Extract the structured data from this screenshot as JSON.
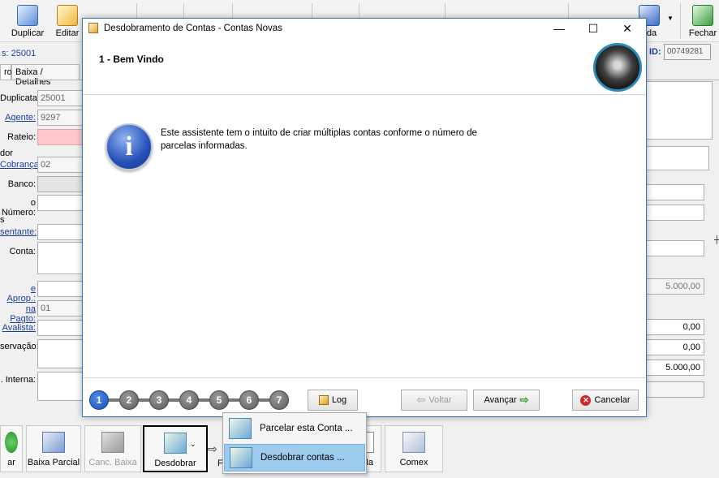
{
  "toolbar": {
    "items": [
      {
        "label": "Duplicar",
        "icon": "duplicate-icon"
      },
      {
        "label": "Editar",
        "icon": "edit-icon"
      },
      {
        "label": "uda",
        "icon": "help-icon"
      },
      {
        "label": "Fechar",
        "icon": "close-app-icon"
      }
    ]
  },
  "form": {
    "header_number": "s: 25001",
    "id_label": "ID:",
    "id_value": "00749281",
    "tabs": [
      "ro",
      "Baixa / Detalhes"
    ],
    "fields": {
      "duplicata": {
        "label": "Duplicata:",
        "value": "25001"
      },
      "agente": {
        "label": "Agente:",
        "value": "9297"
      },
      "rateio": {
        "label": "Rateio:"
      },
      "section_dor": "dor",
      "cobranca": {
        "label": "Cobrança:",
        "value": "02"
      },
      "banco": {
        "label": "Banco:"
      },
      "numero": {
        "label": "o Número:"
      },
      "section_s": "s",
      "sentante": {
        "label": "sentante:"
      },
      "conta": {
        "label": "Conta:"
      },
      "aprop": {
        "label": "e Aprop.:"
      },
      "pagto": {
        "label": "na Pagto:",
        "value": "01"
      },
      "avalista": {
        "label": "Avalista:"
      },
      "servacao": {
        "label": "servação:"
      },
      "interna": {
        "label": ". Interna:"
      }
    },
    "right_values": [
      "5.000,00",
      "0,00",
      "0,00",
      "5.000,00"
    ]
  },
  "dialog": {
    "title": "Desdobramento de Contas - Contas Novas",
    "step_title": "1 - Bem Vindo",
    "message": "Este assistente tem o intuito de criar múltiplas contas conforme o número de parcelas informadas.",
    "steps": [
      "1",
      "2",
      "3",
      "4",
      "5",
      "6",
      "7"
    ],
    "active_step": 1,
    "buttons": {
      "log": "Log",
      "back": "Voltar",
      "next": "Avançar",
      "cancel": "Cancelar"
    },
    "minimize": "—",
    "maximize": "☐",
    "close": "✕"
  },
  "bottom_toolbar": {
    "items": [
      {
        "label": "ar",
        "icon": "check-icon"
      },
      {
        "label": "Baixa Parcial",
        "icon": "partial-payment-icon"
      },
      {
        "label": "Canc. Baixa",
        "icon": "cancel-payment-icon"
      },
      {
        "label": "Desdobrar",
        "icon": "split-icon"
      },
      {
        "label": "Na",
        "icon": "document-icon"
      },
      {
        "label": "Comex",
        "icon": "comex-icon"
      }
    ],
    "partial_label": "F"
  },
  "dropdown": {
    "items": [
      "Parcelar esta Conta ...",
      "Desdobrar contas ..."
    ],
    "highlighted": 1
  },
  "colors": {
    "accent": "#1a3e9e",
    "active_step": "#1a4fb8",
    "menu_highlight": "#9ccbee"
  }
}
